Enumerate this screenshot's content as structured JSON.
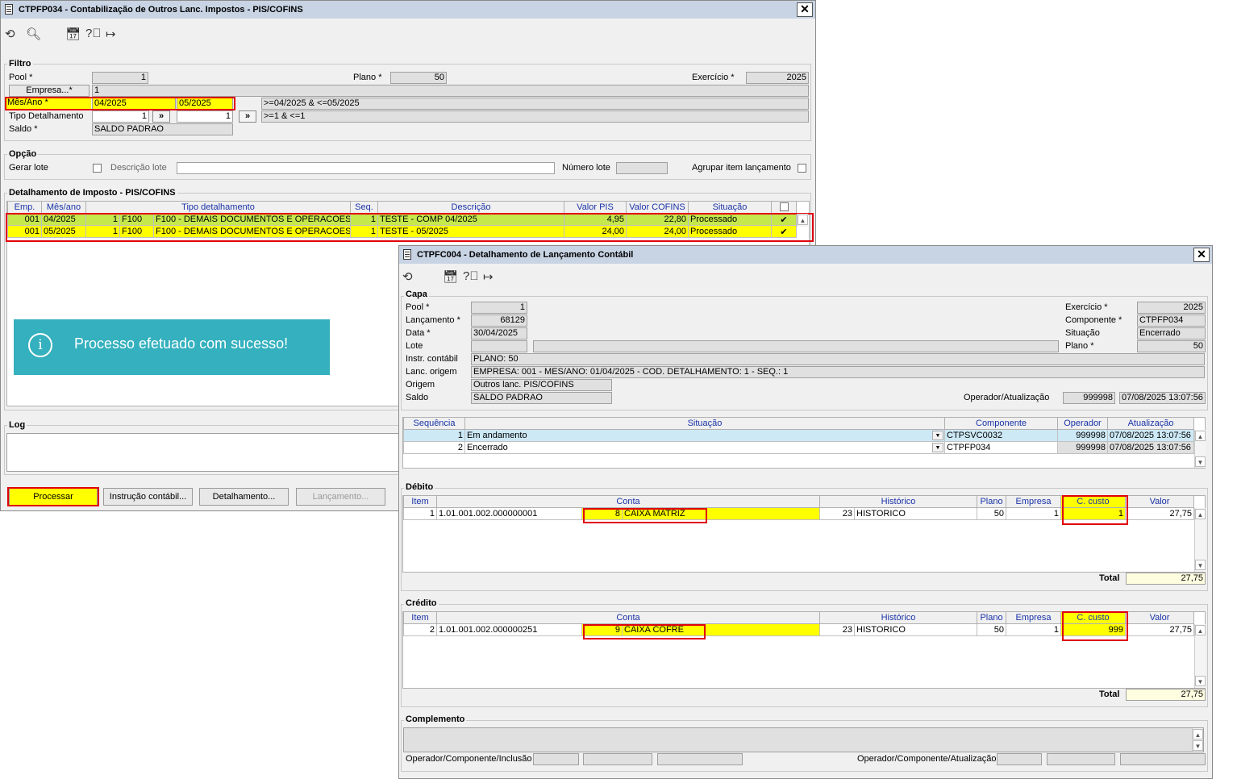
{
  "win1": {
    "title": "CTPFP034 - Contabilização de Outros Lanc. Impostos - PIS/COFINS",
    "close": "✕",
    "filtro": {
      "title": "Filtro",
      "pool_label": "Pool *",
      "pool_value": "1",
      "plano_label": "Plano *",
      "plano_value": "50",
      "exercicio_label": "Exercício *",
      "exercicio_value": "2025",
      "empresa_label": "Empresa...*",
      "empresa_value": "1",
      "mesano_label": "Mês/Ano *",
      "mesano_from": "04/2025",
      "mesano_to": "05/2025",
      "mesano_expr": ">=04/2025 & <=05/2025",
      "tipo_label": "Tipo Detalhamento",
      "tipo_from": "1",
      "tipo_to": "1",
      "tipo_expr": ">=1 & <=1",
      "tipo_btn": "»",
      "saldo_label": "Saldo *",
      "saldo_value": "SALDO PADRAO"
    },
    "opcao": {
      "title": "Opção",
      "gerar_lote": "Gerar lote",
      "descricao_lote": "Descrição lote",
      "numero_lote": "Número lote",
      "agrupar": "Agrupar item lançamento"
    },
    "detalhamento": {
      "title": "Detalhamento de Imposto - PIS/COFINS",
      "columns": [
        "Emp.",
        "Mês/ano",
        "Tipo detalhamento",
        "",
        "Seq.",
        "Descrição",
        "Valor PIS",
        "Valor COFINS",
        "Situação"
      ],
      "rows": [
        {
          "emp": "001",
          "mesano": "04/2025",
          "tipo_num": "1",
          "tipo_cod": "F100",
          "tipo_desc": "F100 - DEMAIS DOCUMENTOS E OPERACOES GER",
          "seq": "1",
          "descricao": "TESTE - COMP 04/2025",
          "pis": "4,95",
          "cofins": "22,80",
          "situacao": "Processado",
          "check": "✔"
        },
        {
          "emp": "001",
          "mesano": "05/2025",
          "tipo_num": "1",
          "tipo_cod": "F100",
          "tipo_desc": "F100 - DEMAIS DOCUMENTOS E OPERACOES GER",
          "seq": "1",
          "descricao": "TESTE - 05/2025",
          "pis": "24,00",
          "cofins": "24,00",
          "situacao": "Processado",
          "check": "✔"
        }
      ]
    },
    "toast": "Processo efetuado com sucesso!",
    "log_title": "Log",
    "buttons": {
      "processar": "Processar",
      "instrucao": "Instrução contábil...",
      "detalhamento": "Detalhamento...",
      "lancamento": "Lançamento..."
    }
  },
  "win2": {
    "title": "CTPFC004 - Detalhamento de Lançamento Contábil",
    "close": "✕",
    "capa": {
      "title": "Capa",
      "pool_label": "Pool *",
      "pool_value": "1",
      "lancamento_label": "Lançamento *",
      "lancamento_value": "68129",
      "data_label": "Data *",
      "data_value": "30/04/2025",
      "lote_label": "Lote",
      "instr_label": "Instr. contábil",
      "instr_value": "PLANO: 50",
      "lanc_origem_label": "Lanc. origem",
      "lanc_origem_value": "EMPRESA: 001 - MES/ANO: 01/04/2025 - COD. DETALHAMENTO: 1 - SEQ.: 1",
      "origem_label": "Origem",
      "origem_value": "Outros lanc. PIS/COFINS",
      "saldo_label": "Saldo",
      "saldo_value": "SALDO PADRAO",
      "exercicio_label": "Exercício *",
      "exercicio_value": "2025",
      "componente_label": "Componente *",
      "componente_value": "CTPFP034",
      "situacao_label": "Situação",
      "situacao_value": "Encerrado",
      "plano_label": "Plano *",
      "plano_value": "50",
      "operador_label": "Operador/Atualização",
      "operador_value": "999998",
      "atualizacao_value": "07/08/2025 13:07:56"
    },
    "status_table": {
      "columns": [
        "Sequência",
        "Situação",
        "Componente",
        "Operador",
        "Atualização"
      ],
      "rows": [
        {
          "seq": "1",
          "situacao": "Em andamento",
          "componente": "CTPSVC0032",
          "operador": "999998",
          "atualizacao": "07/08/2025 13:07:56"
        },
        {
          "seq": "2",
          "situacao": "Encerrado",
          "componente": "CTPFP034",
          "operador": "999998",
          "atualizacao": "07/08/2025 13:07:56"
        }
      ]
    },
    "debito": {
      "title": "Débito",
      "columns": [
        "Item",
        "Conta",
        "",
        "Histórico",
        "",
        "Plano",
        "Empresa",
        "C. custo",
        "Valor"
      ],
      "row": {
        "item": "1",
        "conta": "1.01.001.002.000000001",
        "conta_num": "8",
        "conta_nome": "CAIXA MATRIZ",
        "hist_num": "23",
        "historico": "HISTORICO",
        "plano": "50",
        "empresa": "1",
        "ccusto": "1",
        "valor": "27,75"
      },
      "total_label": "Total",
      "total_value": "27,75"
    },
    "credito": {
      "title": "Crédito",
      "columns": [
        "Item",
        "Conta",
        "",
        "Histórico",
        "",
        "Plano",
        "Empresa",
        "C. custo",
        "Valor"
      ],
      "row": {
        "item": "2",
        "conta": "1.01.001.002.000000251",
        "conta_num": "9",
        "conta_nome": "CAIXA COFRE",
        "hist_num": "23",
        "historico": "HISTORICO",
        "plano": "50",
        "empresa": "1",
        "ccusto": "999",
        "valor": "27,75"
      },
      "total_label": "Total",
      "total_value": "27,75"
    },
    "complemento": {
      "title": "Complemento",
      "inclusao_label": "Operador/Componente/Inclusão",
      "atualizacao_label": "Operador/Componente/Atualização"
    }
  },
  "colors": {
    "highlight": "#ffff00",
    "redbox": "#e0000c",
    "toast": "#34b0be",
    "header_text": "#1a33a8",
    "titlebar": "#c8d4e4"
  },
  "icons": [
    "refresh-icon",
    "search-icon",
    "calendar-icon",
    "help-icon",
    "exit-icon",
    "info-icon",
    "close-icon"
  ]
}
